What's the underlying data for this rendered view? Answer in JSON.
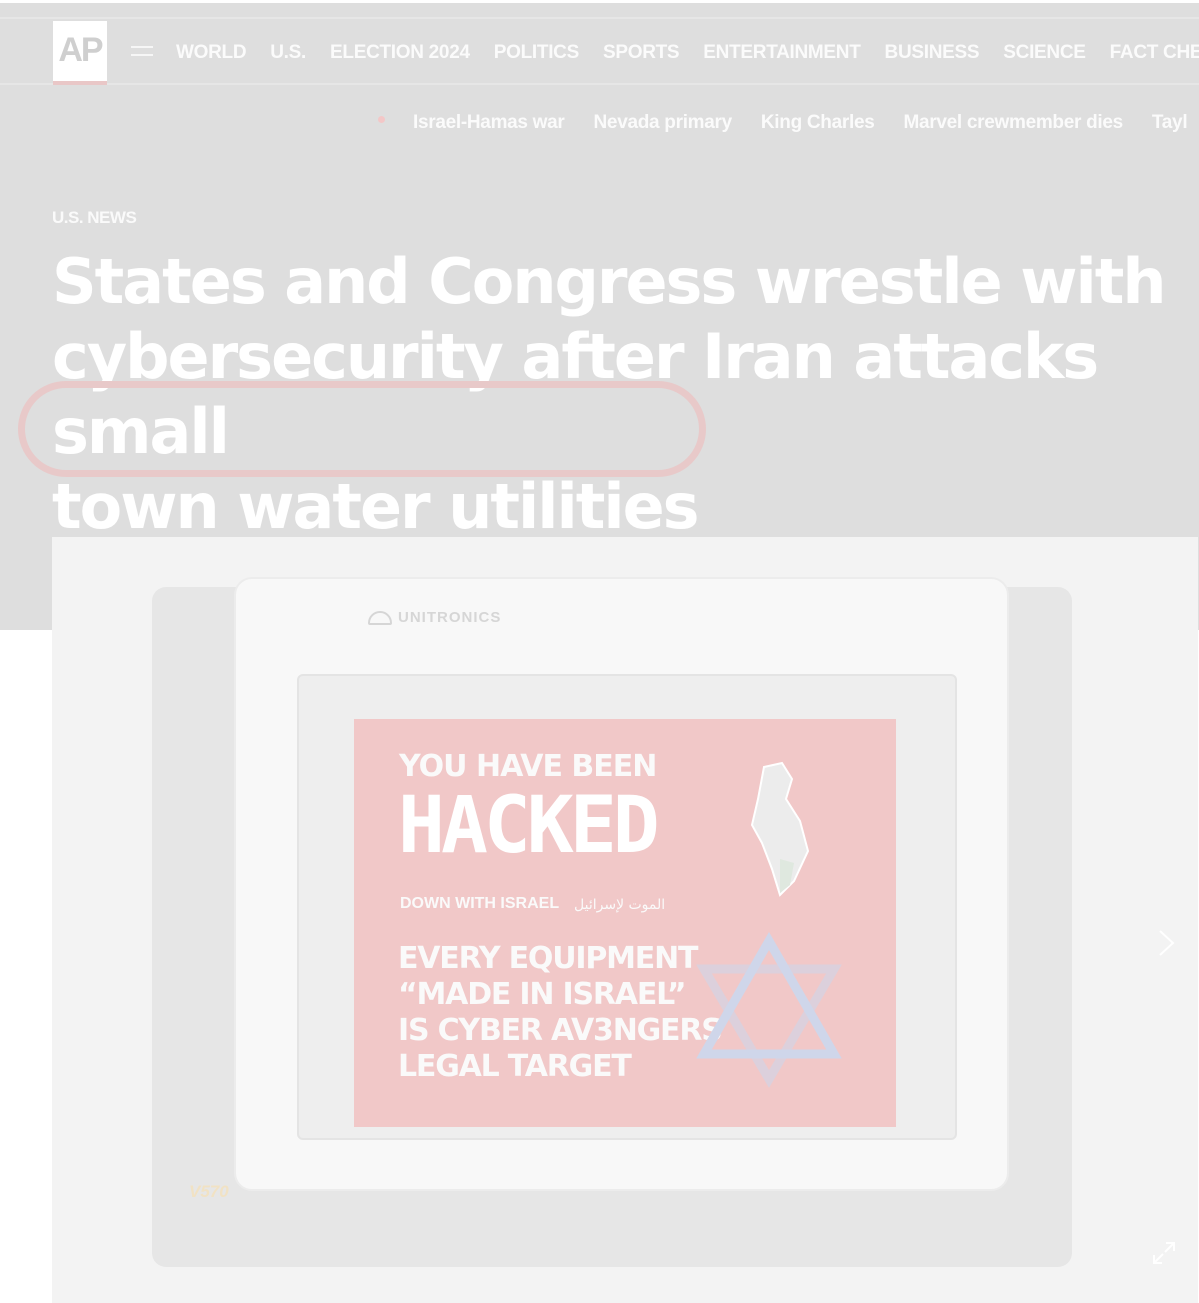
{
  "site": {
    "logo": "AP"
  },
  "nav": {
    "items": [
      "WORLD",
      "U.S.",
      "ELECTION 2024",
      "POLITICS",
      "SPORTS",
      "ENTERTAINMENT",
      "BUSINESS",
      "SCIENCE",
      "FACT CHECK"
    ]
  },
  "trending": {
    "items": [
      "Israel-Hamas war",
      "Nevada primary",
      "King Charles",
      "Marvel crewmember dies",
      "Tayl"
    ]
  },
  "article": {
    "kicker": "U.S. NEWS",
    "headline_line1": "States and Congress wrestle with",
    "headline_line2": "cybersecurity after Iran attacks small",
    "headline_line3": "town water utilities"
  },
  "hero_image": {
    "brand": "UNITRONICS",
    "model": "V570",
    "screen_line1": "YOU HAVE BEEN",
    "screen_line2": "HACKED",
    "screen_line3": "DOWN WITH ISRAEL",
    "screen_arabic": "الموت لإسرائيل",
    "screen_line4": "EVERY EQUIPMENT",
    "screen_line5": "“MADE IN ISRAEL”",
    "screen_line6": "IS CYBER AV3NGERS",
    "screen_line7": "LEGAL TARGET"
  },
  "colors": {
    "overlay_gray": "#dedede",
    "highlight": "#e8c9c9",
    "screen_red": "#f1c8c8"
  },
  "icons": [
    "menu-icon",
    "chevron-right-icon",
    "expand-icon"
  ]
}
